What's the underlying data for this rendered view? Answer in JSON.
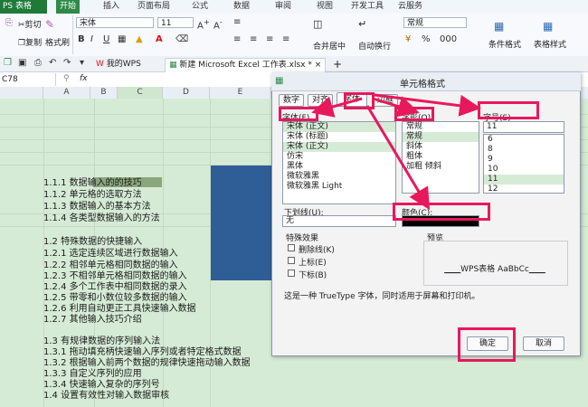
{
  "app": {
    "button": "PS 表格"
  },
  "menu": [
    "开始",
    "插入",
    "页面布局",
    "公式",
    "数据",
    "审阅",
    "视图",
    "开发工具",
    "云服务"
  ],
  "ribbon": {
    "cut": "剪切",
    "copy": "复制",
    "format_painter": "格式刷",
    "font": "宋体",
    "size": "11",
    "number_format": "常规",
    "merge": "合并居中",
    "wrap": "自动换行",
    "cond_format": "条件格式",
    "table_style": "表格样式"
  },
  "doc_tabs": [
    "我的WPS",
    "新建 Microsoft Excel 工作表.xlsx *"
  ],
  "formula": {
    "namebox": "C78",
    "fx": "fx"
  },
  "columns": [
    "A",
    "B",
    "C",
    "D",
    "E"
  ],
  "rows": [
    "1.1.1 数据输入的的技巧",
    "1.1.2 单元格的选取方法",
    "1.1.3 数据输入的基本方法",
    "1.1.4 各类型数据输入的方法",
    "",
    "1.2 特殊数据的快捷输入",
    "1.2.1 选定连续区域进行数据输入",
    "1.2.2 相邻单元格相同数据的输入",
    "1.2.3 不相邻单元格相同数据的输入",
    "1.2.4 多个工作表中相同数据的录入",
    "1.2.5 带零和小数位较多数据的输入",
    "1.2.6 利用自动更正工具快速输入数据",
    "1.2.7 其他输入技巧介绍",
    "",
    "1.3 有规律数据的序列输入法",
    "1.3.1 拖动填充柄快速输入序列或者特定格式数据",
    "1.3.2 根据输入前两个数据的规律快速拖动输入数据",
    "1.3.3 自定义序列的应用",
    "1.3.4 快速输入复杂的序列号",
    "1.4 设置有效性对输入数据审核"
  ],
  "dialog": {
    "title": "单元格格式",
    "tabs": [
      "数字",
      "对齐",
      "字体",
      "边框"
    ],
    "font_label": "字体(F)",
    "style_label": "字形(O)",
    "size_label": "字号(S)",
    "font_list": [
      "宋体 (正文)",
      "宋体 (标题)",
      "宋体 (正文)",
      "仿宋",
      "黑体",
      "微软雅黑",
      "微软雅黑 Light"
    ],
    "style_list": [
      "常规",
      "常规",
      "斜体",
      "粗体",
      "加粗 倾斜"
    ],
    "size_value": "11",
    "size_list": [
      "6",
      "8",
      "9",
      "10",
      "11",
      "12"
    ],
    "underline_label": "下划线(U):",
    "underline_value": "无",
    "color_label": "颜色(C):",
    "effects_label": "特殊效果",
    "effects": [
      "删除线(K)",
      "上标(E)",
      "下标(B)"
    ],
    "preview_label": "预览",
    "preview_text": "WPS表格  AaBbCc",
    "note": "这是一种 TrueType 字体，同时适用于屏幕和打印机。",
    "ok": "确定",
    "cancel": "取消"
  },
  "colors": {
    "accent": "#e8185c",
    "green": "#2d8a47",
    "blue": "#2f5d96"
  }
}
